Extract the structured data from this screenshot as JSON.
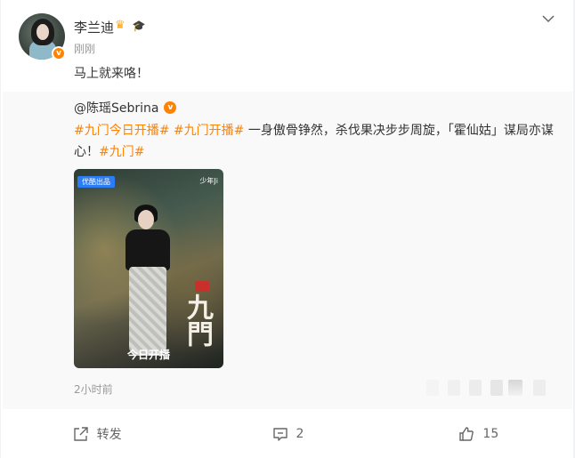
{
  "post": {
    "author": "李兰迪",
    "time": "刚刚",
    "text": "马上就来咯！"
  },
  "repost": {
    "author": "@陈瑶Sebrina",
    "segments": [
      {
        "text": "#九门今日开播#",
        "type": "tag"
      },
      {
        "text": " ",
        "type": "plain"
      },
      {
        "text": "#九门开播#",
        "type": "tag"
      },
      {
        "text": " 一身傲骨铮然，杀伐果决步步周旋，「霍仙姑」谋局亦谋心！",
        "type": "plain"
      },
      {
        "text": "#九门#",
        "type": "tag"
      }
    ],
    "poster": {
      "badge": "优酷出品",
      "brand": "少年Ji",
      "calligraphy": "九門",
      "caption": "今日开播"
    },
    "time": "2小时前"
  },
  "actions": {
    "repost_label": "转发",
    "comment_count": "2",
    "like_count": "15"
  },
  "icons": {
    "verified": "orange-v-badge-icon",
    "crown": "crown-icon",
    "cap": "graduation-cap-icon",
    "more": "chevron-down-icon",
    "repost": "share-icon",
    "comment": "comment-icon",
    "like": "thumbs-up-icon"
  },
  "colors": {
    "tag": "#ff8200",
    "verified": "#ff8200",
    "background": "#f1f2f5",
    "repost_bg": "#f9f9f9"
  }
}
